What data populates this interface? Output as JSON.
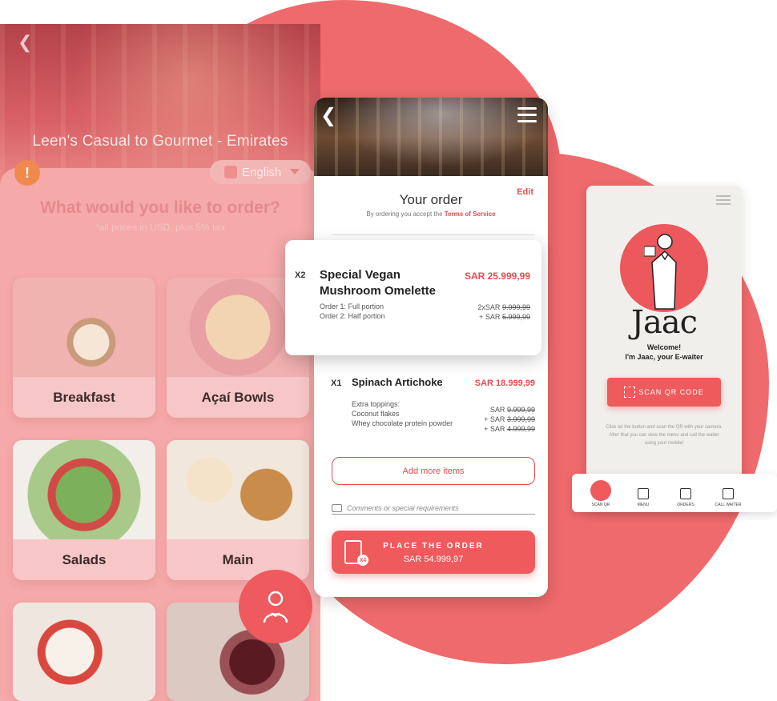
{
  "left": {
    "restaurant_title": "Leen's Casual to Gourmet - Emirates",
    "alert_glyph": "!",
    "language": "English",
    "question": "What would you like to order?",
    "price_note": "*all prices in USD, plus 5% tax",
    "categories": [
      {
        "label": "Breakfast"
      },
      {
        "label": "Açaí Bowls"
      },
      {
        "label": "Salads"
      },
      {
        "label": "Main"
      }
    ]
  },
  "order": {
    "title": "Your order",
    "edit": "Edit",
    "terms_prefix": "By ordering you accept the",
    "terms_link": "Terms of Service",
    "items": [
      {
        "qty": "X2",
        "name": "Special Vegan Mushroom Omelette",
        "price": "SAR 25.999,99",
        "lines": [
          "Order 1: Full portion",
          "Order 2: Half portion"
        ],
        "line_prices": [
          {
            "prefix": "2xSAR",
            "value": "9.999,99"
          },
          {
            "prefix": "+ SAR",
            "value": "5.999,99"
          }
        ]
      },
      {
        "qty": "X1",
        "name": "Spinach Artichoke",
        "price": "SAR 18.999,99",
        "lines": [
          "Extra toppings:",
          "Coconut flakes",
          "Whey chocolate protein powder"
        ],
        "line_prices": [
          {
            "prefix": "SAR",
            "value": "9.999,99"
          },
          {
            "prefix": "+ SAR",
            "value": "3.999,99"
          },
          {
            "prefix": "+ SAR",
            "value": "4.999,99"
          }
        ]
      }
    ],
    "add_more": "Add more items",
    "comments_placeholder": "Comments or special requirements",
    "place_label": "PLACE THE ORDER",
    "place_total": "SAR 54.999,97",
    "badge": "X4"
  },
  "jaac": {
    "brand": "Jaac",
    "welcome_1": "Welcome!",
    "welcome_2": "I'm Jaac, your E-waiter",
    "scan_label": "SCAN QR CODE",
    "help": "Click on the button and scan the QR with your camera. After that you can view the menu and call the waiter using your mobile!",
    "tabs": [
      "SCAN QR",
      "MENU",
      "ORDERS",
      "CALL WAITER"
    ]
  },
  "colors": {
    "accent": "#ef5a5c",
    "blob": "#ef6a6c",
    "link": "#e54b50"
  }
}
